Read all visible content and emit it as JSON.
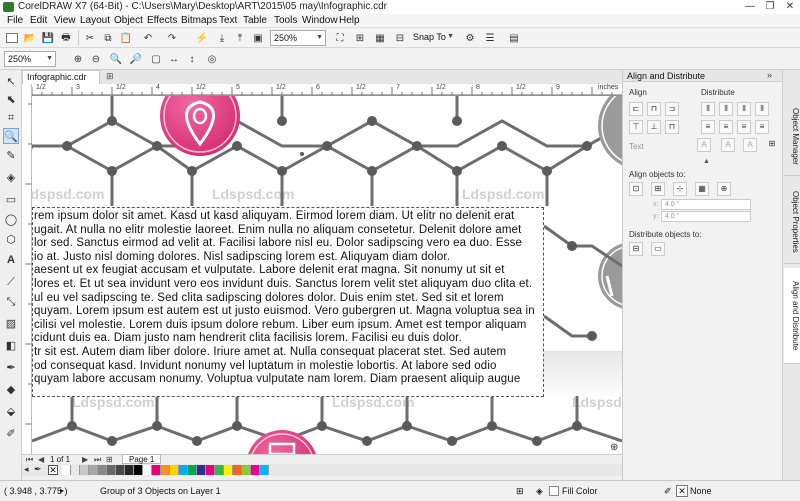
{
  "app": {
    "title": "CorelDRAW X7 (64-Bit) - C:\\Users\\Mary\\Desktop\\ART\\2015\\05 may\\Infographic.cdr"
  },
  "window_controls": {
    "minimize": "—",
    "restore": "❐",
    "close": "✕"
  },
  "menu": [
    "File",
    "Edit",
    "View",
    "Layout",
    "Object",
    "Effects",
    "Bitmaps",
    "Text",
    "Table",
    "Tools",
    "Window",
    "Help"
  ],
  "toolbar": {
    "zoom_value": "250%",
    "snap_to": "Snap To"
  },
  "propertybar": {
    "zoom_value": "250%"
  },
  "document": {
    "tab": "Infographic.cdr",
    "ruler_units": "inches"
  },
  "ruler_labels": [
    "1/2",
    "3",
    "1/2",
    "4",
    "1/2",
    "5",
    "1/2",
    "6",
    "1/2",
    "7",
    "1/2",
    "8",
    "1/2",
    "9"
  ],
  "paragraph_lines": [
    "rem ipsum dolor sit amet. Kasd ut kasd aliquyam. Eirmod lorem diam. Ut elitr no delenit erat",
    "ugait. At nulla no elitr molestie laoreet. Enim nulla no aliquam consetetur. Delenit dolore amet",
    "lor sed. Sanctus eirmod ad velit at. Facilisi labore nisl eu. Dolor sadipscing vero ea duo. Esse",
    "io at. Justo nisl doming dolores. Nisl sadipscing lorem est. Aliquyam diam dolor.",
    "aesent ut ex feugiat accusam et vulputate. Labore delenit erat magna. Sit nonumy ut sit et",
    "lores et. Et ut sea invidunt vero eos invidunt duis. Sanctus lorem velit stet aliquyam duo clita et.",
    "ul eu vel sadipscing te. Sed clita sadipscing dolores dolor. Duis enim stet. Sed sit et lorem",
    "quyam. Lorem ipsum est autem est ut justo euismod. Vero gubergren ut. Magna voluptua sea in",
    "cilisi vel molestie. Lorem duis ipsum dolore rebum. Liber eum ipsum. Amet est tempor aliquam",
    "cidunt duis ea. Diam justo nam hendrerit clita facilisis lorem. Facilisi eu duis dolor.",
    "tr sit est. Autem diam liber dolore. Iriure amet at. Nulla consequat placerat stet. Sed autem",
    "od consequat kasd. Invidunt nonumy vel luptatum in molestie lobortis. At labore sed odio",
    "quyam labore accusam nonumy. Voluptua vulputate nam lorem. Diam praesent aliquip augue"
  ],
  "watermarks": [
    "Ldspsd.com",
    "Ldspsd.com",
    "Ldspsd.com",
    "Ldspsd.com",
    "Ldspsd.com",
    "Ldspsd.com"
  ],
  "page_nav": {
    "counter": "1 of 1",
    "page_tab": "Page 1"
  },
  "palette_colors": [
    "#ffffff",
    "#e8e8e8",
    "#c8c8c8",
    "#a8a8a8",
    "#888888",
    "#686868",
    "#484848",
    "#282828",
    "#000000",
    "#ffffff",
    "#e6007e",
    "#f7941d",
    "#ffd400",
    "#00aeef",
    "#00a651",
    "#2e3192",
    "#e5007d",
    "#39b54a",
    "#fff200",
    "#f26522",
    "#8dc63f",
    "#ec008c",
    "#00b9f2"
  ],
  "dock": {
    "title": "Align and Distribute",
    "align_label": "Align",
    "distribute_label": "Distribute",
    "text_label": "Text",
    "align_objects_to": "Align objects to:",
    "x_value": "4.0 \"",
    "y_value": "4.0 \"",
    "distribute_objects_to": "Distribute objects to:"
  },
  "side_tabs": [
    "Object Manager",
    "Object Properties",
    "Align and Distribute"
  ],
  "status": {
    "coords": "( 3.948 , 3.775 )",
    "selection": "Group of 3 Objects on Layer 1",
    "fill": "Fill Color",
    "outline": "None"
  },
  "colors": {
    "accent_pink": "#e2397f",
    "hex_gray": "#707070",
    "node_gray": "#5a5a5a"
  }
}
